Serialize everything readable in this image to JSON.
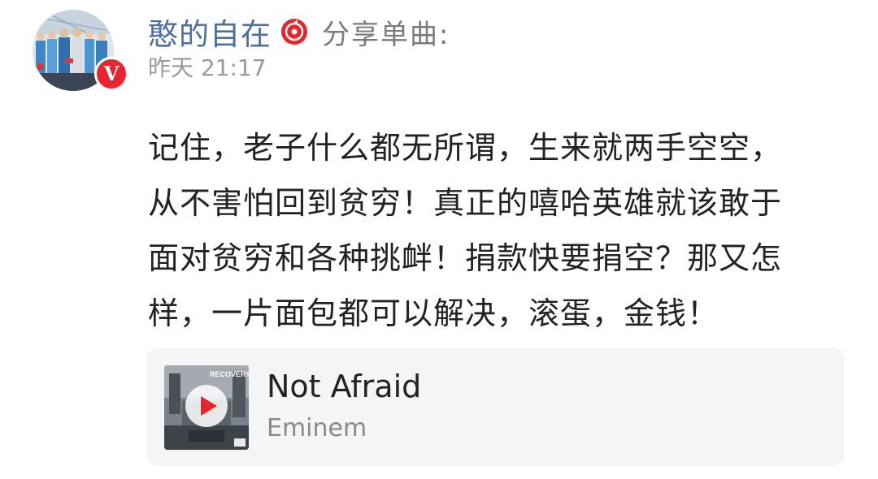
{
  "post": {
    "username": "憨的自在",
    "share_label": "分享单曲:",
    "timestamp": "昨天 21:17",
    "verified_badge": "V",
    "body_lines": [
      "记住，老子什么都无所谓，生来就两手空空，",
      "从不害怕回到贫穷！真正的嘻哈英雄就该敢于",
      "面对贫穷和各种挑衅！捐款快要捐空？那又怎",
      "样，一片面包都可以解决，滚蛋，金钱！"
    ]
  },
  "music_card": {
    "title": "Not Afraid",
    "artist": "Eminem",
    "cover_text": "RECOVERY",
    "play_icon": "play-icon"
  },
  "colors": {
    "username": "#4b6ea3",
    "music_icon": "#e8242d",
    "verified_badge": "#e8242d",
    "card_bg": "#f5f5f7"
  }
}
